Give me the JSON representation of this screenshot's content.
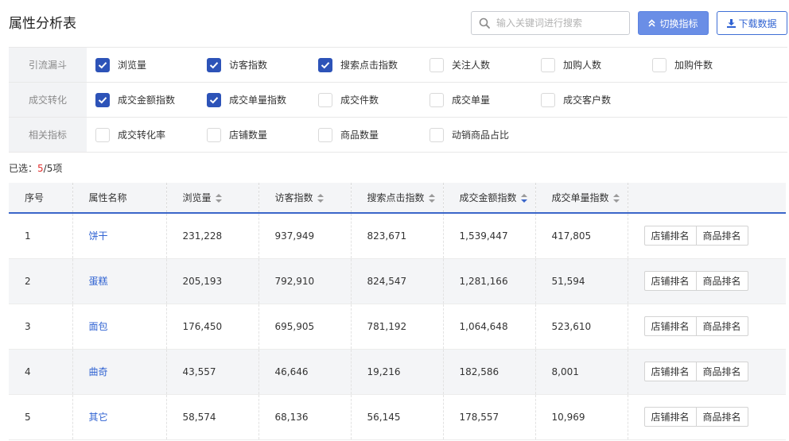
{
  "header": {
    "title": "属性分析表",
    "search_placeholder": "输入关键词进行搜索",
    "switch_label": "切换指标",
    "download_label": "下载数据"
  },
  "filters": [
    {
      "label": "引流漏斗",
      "options": [
        {
          "label": "浏览量",
          "checked": true
        },
        {
          "label": "访客指数",
          "checked": true
        },
        {
          "label": "搜索点击指数",
          "checked": true
        },
        {
          "label": "关注人数",
          "checked": false
        },
        {
          "label": "加购人数",
          "checked": false
        },
        {
          "label": "加购件数",
          "checked": false
        }
      ]
    },
    {
      "label": "成交转化",
      "options": [
        {
          "label": "成交金额指数",
          "checked": true
        },
        {
          "label": "成交单量指数",
          "checked": true
        },
        {
          "label": "成交件数",
          "checked": false
        },
        {
          "label": "成交单量",
          "checked": false
        },
        {
          "label": "成交客户数",
          "checked": false
        }
      ]
    },
    {
      "label": "相关指标",
      "options": [
        {
          "label": "成交转化率",
          "checked": false
        },
        {
          "label": "店铺数量",
          "checked": false
        },
        {
          "label": "商品数量",
          "checked": false
        },
        {
          "label": "动销商品占比",
          "checked": false
        }
      ]
    }
  ],
  "selection": {
    "prefix": "已选：",
    "count": "5",
    "suffix": "/5项"
  },
  "table": {
    "columns": [
      {
        "label": "序号",
        "sortable": false,
        "sort": ""
      },
      {
        "label": "属性名称",
        "sortable": false,
        "sort": ""
      },
      {
        "label": "浏览量",
        "sortable": true,
        "sort": ""
      },
      {
        "label": "访客指数",
        "sortable": true,
        "sort": ""
      },
      {
        "label": "搜索点击指数",
        "sortable": true,
        "sort": ""
      },
      {
        "label": "成交金额指数",
        "sortable": true,
        "sort": "desc"
      },
      {
        "label": "成交单量指数",
        "sortable": true,
        "sort": ""
      },
      {
        "label": "",
        "sortable": false,
        "sort": ""
      }
    ],
    "rows": [
      {
        "index": "1",
        "name": "饼干",
        "pv": "231,228",
        "visitors": "937,949",
        "search_clicks": "823,671",
        "gmv_index": "1,539,447",
        "orders_index": "417,805"
      },
      {
        "index": "2",
        "name": "蛋糕",
        "pv": "205,193",
        "visitors": "792,910",
        "search_clicks": "824,547",
        "gmv_index": "1,281,166",
        "orders_index": "51,594"
      },
      {
        "index": "3",
        "name": "面包",
        "pv": "176,450",
        "visitors": "695,905",
        "search_clicks": "781,192",
        "gmv_index": "1,064,648",
        "orders_index": "523,610"
      },
      {
        "index": "4",
        "name": "曲奇",
        "pv": "43,557",
        "visitors": "46,646",
        "search_clicks": "19,216",
        "gmv_index": "182,586",
        "orders_index": "8,001"
      },
      {
        "index": "5",
        "name": "其它",
        "pv": "58,574",
        "visitors": "68,136",
        "search_clicks": "56,145",
        "gmv_index": "178,557",
        "orders_index": "10,969"
      }
    ],
    "row_actions": [
      "店铺排名",
      "商品排名"
    ]
  },
  "colors": {
    "accent": "#2d53b8",
    "primary_button": "#6a8ee6",
    "link": "#2f62d2",
    "highlight_count": "#e0302f"
  }
}
